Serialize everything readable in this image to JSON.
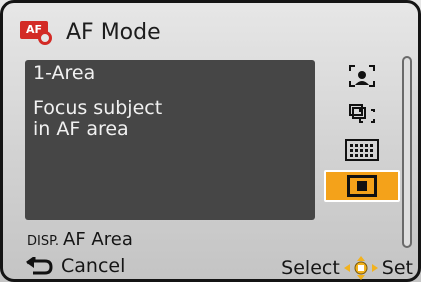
{
  "header": {
    "icon_text": "AF",
    "title": "AF Mode"
  },
  "panel": {
    "mode_name": "1-Area",
    "description_line1": "Focus subject",
    "description_line2": "in AF area"
  },
  "options": [
    {
      "icon": "face-detection-icon",
      "selected": false
    },
    {
      "icon": "af-tracking-icon",
      "selected": false
    },
    {
      "icon": "multi-area-icon",
      "selected": false
    },
    {
      "icon": "one-area-icon",
      "selected": true
    }
  ],
  "footer": {
    "disp_label": "DISP.",
    "disp_action": "AF Area",
    "cancel_label": "Cancel",
    "select_label": "Select",
    "set_label": "Set"
  },
  "colors": {
    "selected": "#f4a21a",
    "panel": "#464646",
    "accent_red": "#d32a25"
  }
}
